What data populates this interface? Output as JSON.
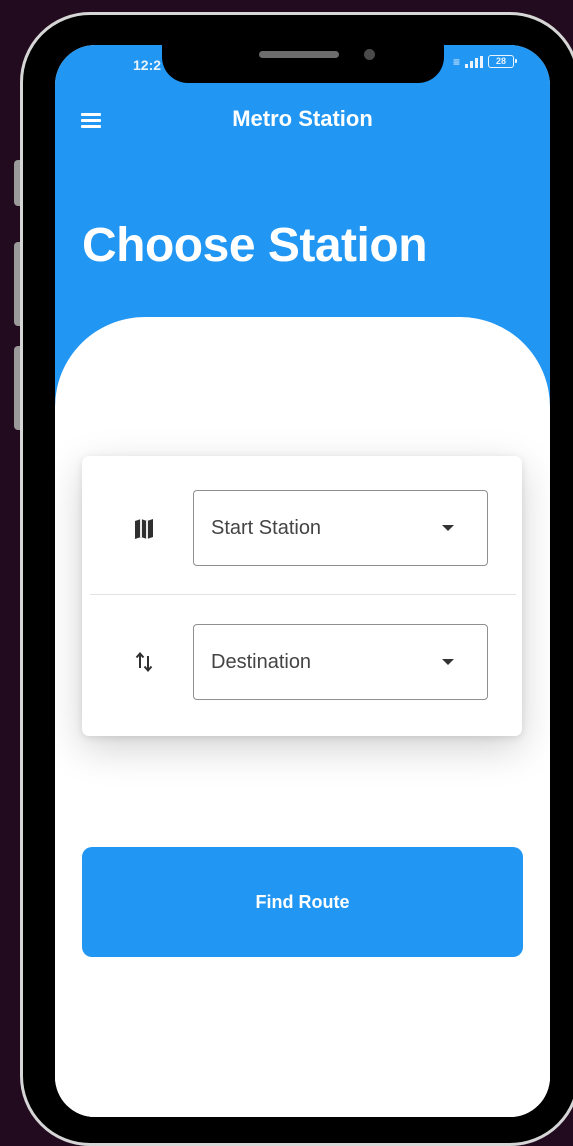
{
  "status_bar": {
    "time": "12:2",
    "battery": "28"
  },
  "app_bar": {
    "title": "Metro Station"
  },
  "page": {
    "heading": "Choose Station"
  },
  "form": {
    "start_station": {
      "value": "Start Station",
      "icon": "map-icon"
    },
    "destination": {
      "value": "Destination",
      "icon": "swap-vertical-icon"
    }
  },
  "actions": {
    "find_route_label": "Find Route"
  },
  "colors": {
    "primary": "#2196f3",
    "background": "#220b1f"
  }
}
